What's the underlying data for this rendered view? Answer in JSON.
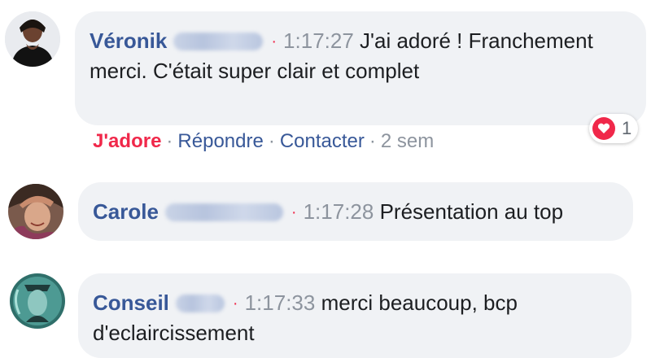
{
  "comments": [
    {
      "author": "Véronik",
      "time": "1:17:27",
      "text": "J'ai adoré ! Franchement merci. C'était super clair et complet",
      "actions": {
        "love": "J'adore",
        "reply": "Répondre",
        "contact": "Contacter",
        "age": "2 sem"
      },
      "reaction_count": "1"
    },
    {
      "author": "Carole",
      "time": "1:17:28",
      "text": "Présentation au top"
    },
    {
      "author": "Conseil",
      "time": "1:17:33",
      "text": "merci beaucoup, bcp d'eclaircissement"
    }
  ],
  "separator": "·",
  "colors": {
    "link": "#385898",
    "love": "#f0284a",
    "bubble": "#f0f2f5",
    "muted": "#8d949e"
  }
}
